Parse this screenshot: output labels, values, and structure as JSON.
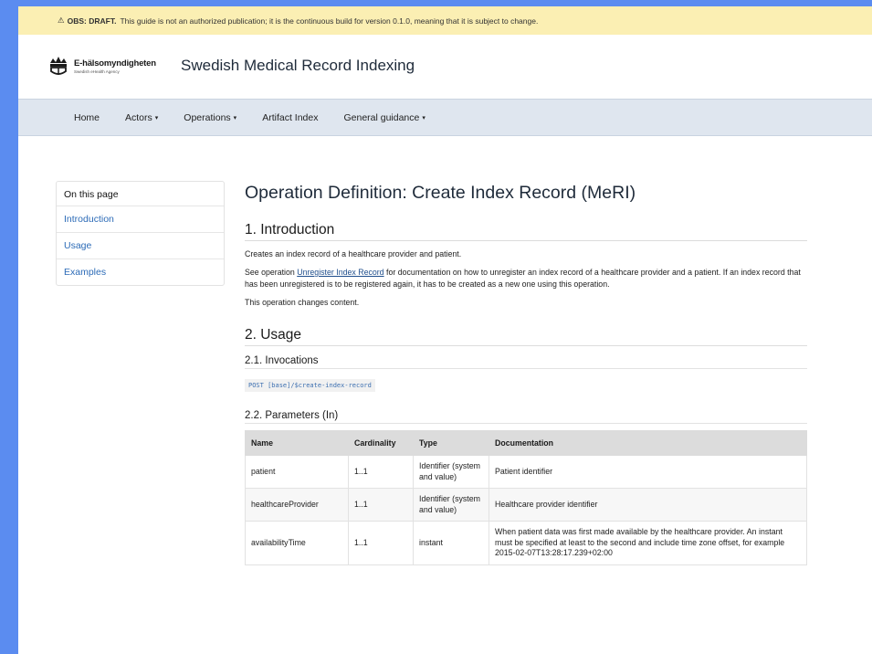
{
  "draft": {
    "warning_glyph": "⚠",
    "label": "OBS: DRAFT.",
    "text": "This guide is not an authorized publication; it is the continuous build for version 0.1.0, meaning that it is subject to change."
  },
  "header": {
    "logo_name": "E-hälsomyndigheten",
    "logo_sub": "Swedish eHealth Agency",
    "site_title": "Swedish Medical Record Indexing"
  },
  "nav": {
    "home": "Home",
    "actors": "Actors",
    "operations": "Operations",
    "artifact_index": "Artifact Index",
    "general_guidance": "General guidance",
    "caret": "▾"
  },
  "sidebar": {
    "heading": "On this page",
    "items": [
      "Introduction",
      "Usage",
      "Examples"
    ]
  },
  "content": {
    "title": "Operation Definition: Create Index Record (MeRI)",
    "intro": {
      "heading": "1. Introduction",
      "p1": "Creates an index record of a healthcare provider and patient.",
      "p2_before": "See operation ",
      "p2_link": "Unregister Index Record",
      "p2_after": " for documentation on how to unregister an index record of a healthcare provider and a patient. If an index record that has been unregistered is to be registered again, it has to be created as a new one using this operation.",
      "p3": "This operation changes content."
    },
    "usage": {
      "heading": "2. Usage",
      "invocations_heading": "2.1. Invocations",
      "invocation": "POST [base]/$create-index-record",
      "params_heading": "2.2. Parameters (In)",
      "columns": [
        "Name",
        "Cardinality",
        "Type",
        "Documentation"
      ],
      "rows": [
        [
          "patient",
          "1..1",
          "Identifier (system and value)",
          "Patient identifier"
        ],
        [
          "healthcareProvider",
          "1..1",
          "Identifier (system and value)",
          "Healthcare provider identifier"
        ],
        [
          "availabilityTime",
          "1..1",
          "instant",
          "When patient data was first made available by the healthcare provider. An instant must be specified at least to the second and include time zone offset, for example 2015-02-07T13:28:17.239+02:00"
        ]
      ]
    }
  },
  "colors": {
    "outer_background": "#5b8cf0",
    "draft_banner": "#fbefb3",
    "navbar": "#dfe6ef",
    "link": "#2c6bb7"
  }
}
